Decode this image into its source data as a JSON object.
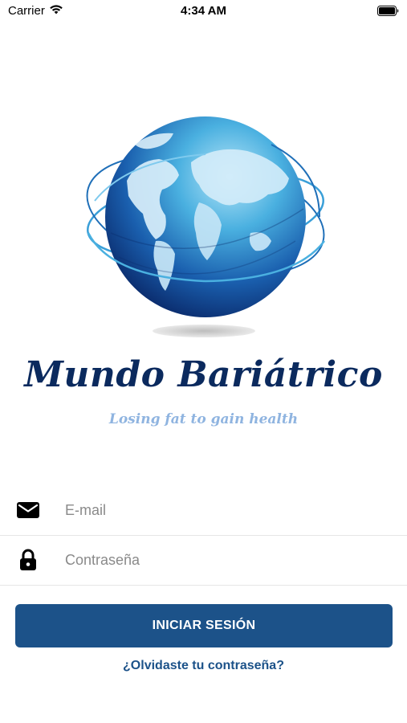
{
  "status_bar": {
    "carrier": "Carrier",
    "time": "4:34 AM",
    "wifi_icon": "wifi-icon",
    "battery_icon": "battery-icon"
  },
  "brand": {
    "title": "Mundo Bariátrico",
    "tagline": "Losing fat to gain health",
    "logo_icon": "globe-logo",
    "colors": {
      "title": "#0b2a5e",
      "tagline": "#8fb4e0",
      "globe_dark": "#0a2a6b",
      "globe_light": "#9ad4f0"
    }
  },
  "form": {
    "email": {
      "placeholder": "E-mail",
      "value": "",
      "icon": "envelope-icon"
    },
    "password": {
      "placeholder": "Contraseña",
      "value": "",
      "icon": "lock-icon"
    },
    "login_label": "INICIAR SESIÓN",
    "forgot_label": "¿Olvidaste tu contraseña?"
  },
  "colors": {
    "accent": "#1c5289",
    "divider": "#e6e6e6",
    "background": "#ffffff"
  }
}
